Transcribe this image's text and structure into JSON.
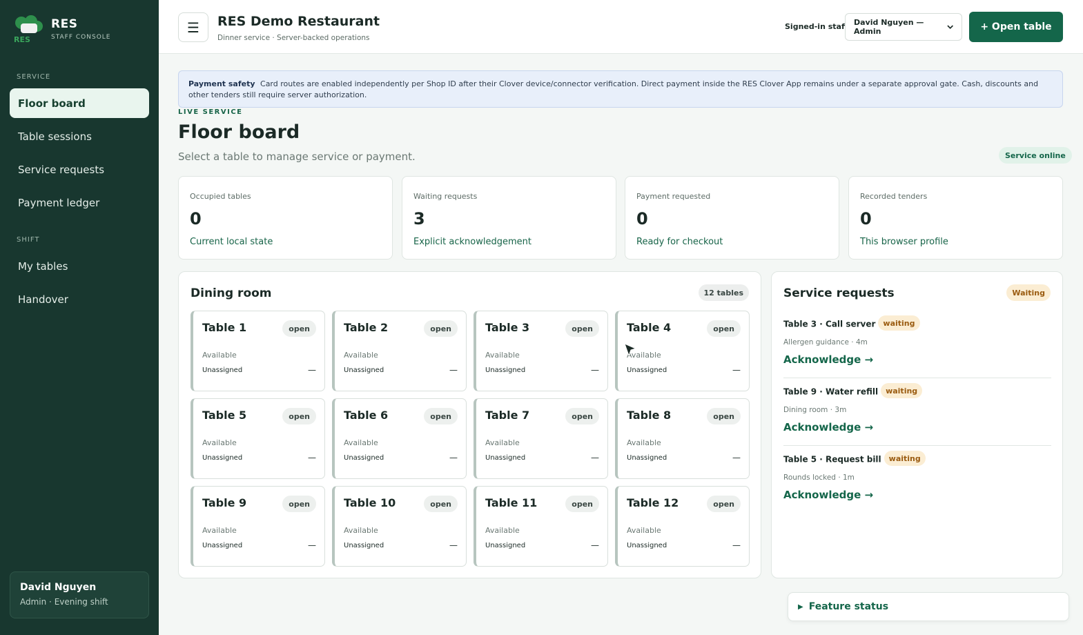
{
  "sidebar": {
    "logo_text": "RES",
    "brand_title": "RES",
    "brand_subtitle": "STAFF CONSOLE",
    "section_service": "SERVICE",
    "section_shift": "SHIFT",
    "items": [
      {
        "label": "Floor board"
      },
      {
        "label": "Table sessions"
      },
      {
        "label": "Service requests"
      },
      {
        "label": "Payment ledger"
      },
      {
        "label": "My tables"
      },
      {
        "label": "Handover"
      }
    ],
    "user": {
      "name": "David Nguyen",
      "role": "Admin · Evening shift"
    }
  },
  "header": {
    "menu_icon": "☰",
    "title": "RES Demo Restaurant",
    "subtitle": "Dinner service · Server-backed operations",
    "staff_label": "Signed-in staff",
    "staff_selected": "David Nguyen — Admin",
    "open_table_label": "+ Open table"
  },
  "notice": {
    "title": "Payment safety",
    "text": "Card routes are enabled independently per Shop ID after their Clover device/connector verification. Direct payment inside the RES Clover App remains under a separate approval gate. Cash, discounts and other tenders still require server authorization."
  },
  "page": {
    "eyebrow": "LIVE SERVICE",
    "title": "Floor board",
    "subtitle": "Select a table to manage service or payment.",
    "status_badge": "Service online"
  },
  "stats": [
    {
      "label": "Occupied tables",
      "value": "0",
      "note": "Current local state"
    },
    {
      "label": "Waiting requests",
      "value": "3",
      "note": "Explicit acknowledgement"
    },
    {
      "label": "Payment requested",
      "value": "0",
      "note": "Ready for checkout"
    },
    {
      "label": "Recorded tenders",
      "value": "0",
      "note": "This browser profile"
    }
  ],
  "dining": {
    "title": "Dining room",
    "count": "12 tables",
    "tables": [
      {
        "name": "Table 1",
        "status": "open",
        "availability": "Available",
        "assignee": "Unassigned",
        "value": "—"
      },
      {
        "name": "Table 2",
        "status": "open",
        "availability": "Available",
        "assignee": "Unassigned",
        "value": "—"
      },
      {
        "name": "Table 3",
        "status": "open",
        "availability": "Available",
        "assignee": "Unassigned",
        "value": "—"
      },
      {
        "name": "Table 4",
        "status": "open",
        "availability": "Available",
        "assignee": "Unassigned",
        "value": "—"
      },
      {
        "name": "Table 5",
        "status": "open",
        "availability": "Available",
        "assignee": "Unassigned",
        "value": "—"
      },
      {
        "name": "Table 6",
        "status": "open",
        "availability": "Available",
        "assignee": "Unassigned",
        "value": "—"
      },
      {
        "name": "Table 7",
        "status": "open",
        "availability": "Available",
        "assignee": "Unassigned",
        "value": "—"
      },
      {
        "name": "Table 8",
        "status": "open",
        "availability": "Available",
        "assignee": "Unassigned",
        "value": "—"
      },
      {
        "name": "Table 9",
        "status": "open",
        "availability": "Available",
        "assignee": "Unassigned",
        "value": "—"
      },
      {
        "name": "Table 10",
        "status": "open",
        "availability": "Available",
        "assignee": "Unassigned",
        "value": "—"
      },
      {
        "name": "Table 11",
        "status": "open",
        "availability": "Available",
        "assignee": "Unassigned",
        "value": "—"
      },
      {
        "name": "Table 12",
        "status": "open",
        "availability": "Available",
        "assignee": "Unassigned",
        "value": "—"
      }
    ]
  },
  "requests": {
    "title": "Service requests",
    "badge": "Waiting",
    "items": [
      {
        "title": "Table 3 · Call server",
        "status": "waiting",
        "meta": "Allergen guidance · 4m",
        "action": "Acknowledge →"
      },
      {
        "title": "Table 9 · Water refill",
        "status": "waiting",
        "meta": "Dining room · 3m",
        "action": "Acknowledge →"
      },
      {
        "title": "Table 5 · Request bill",
        "status": "waiting",
        "meta": "Rounds locked · 1m",
        "action": "Acknowledge →"
      }
    ]
  },
  "feature": {
    "arrow": "▶",
    "label": "Feature status"
  },
  "colors": {
    "sidebar": "#18372f",
    "accent": "#14664a",
    "waiting": "#fbedd3",
    "notice": "#e8effa"
  }
}
